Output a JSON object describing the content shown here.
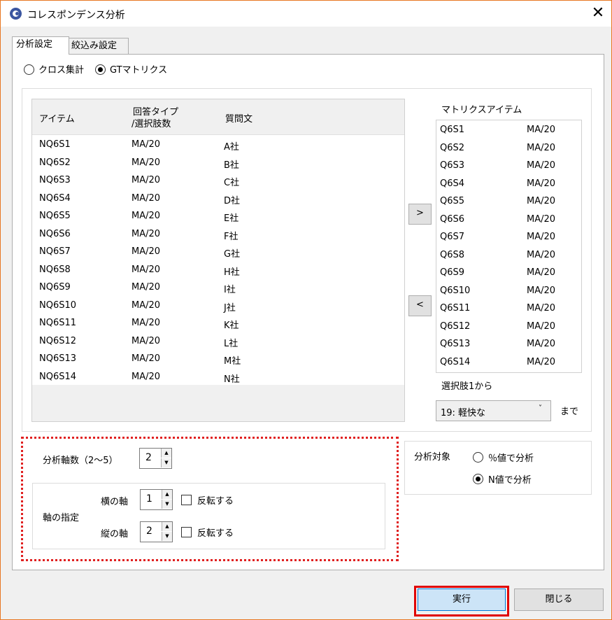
{
  "window": {
    "title": "コレスポンデンス分析"
  },
  "tabs": [
    "分析設定",
    "絞込み設定"
  ],
  "mode": {
    "options": [
      "クロス集計",
      "GTマトリクス"
    ],
    "selected": 1
  },
  "left_list": {
    "headers": {
      "item": "アイテム",
      "type_line1": "回答タイプ",
      "type_line2": "/選択肢数",
      "question": "質問文"
    },
    "rows": [
      [
        "NQ6S1",
        "MA/20",
        "A社"
      ],
      [
        "NQ6S2",
        "MA/20",
        "B社"
      ],
      [
        "NQ6S3",
        "MA/20",
        "C社"
      ],
      [
        "NQ6S4",
        "MA/20",
        "D社"
      ],
      [
        "NQ6S5",
        "MA/20",
        "E社"
      ],
      [
        "NQ6S6",
        "MA/20",
        "F社"
      ],
      [
        "NQ6S7",
        "MA/20",
        "G社"
      ],
      [
        "NQ6S8",
        "MA/20",
        "H社"
      ],
      [
        "NQ6S9",
        "MA/20",
        "I社"
      ],
      [
        "NQ6S10",
        "MA/20",
        "J社"
      ],
      [
        "NQ6S11",
        "MA/20",
        "K社"
      ],
      [
        "NQ6S12",
        "MA/20",
        "L社"
      ],
      [
        "NQ6S13",
        "MA/20",
        "M社"
      ],
      [
        "NQ6S14",
        "MA/20",
        "N社"
      ]
    ]
  },
  "move_buttons": {
    "add": ">",
    "remove": "<"
  },
  "matrix": {
    "label": "マトリクスアイテム",
    "rows": [
      [
        "Q6S1",
        "MA/20"
      ],
      [
        "Q6S2",
        "MA/20"
      ],
      [
        "Q6S3",
        "MA/20"
      ],
      [
        "Q6S4",
        "MA/20"
      ],
      [
        "Q6S5",
        "MA/20"
      ],
      [
        "Q6S6",
        "MA/20"
      ],
      [
        "Q6S7",
        "MA/20"
      ],
      [
        "Q6S8",
        "MA/20"
      ],
      [
        "Q6S9",
        "MA/20"
      ],
      [
        "Q6S10",
        "MA/20"
      ],
      [
        "Q6S11",
        "MA/20"
      ],
      [
        "Q6S12",
        "MA/20"
      ],
      [
        "Q6S13",
        "MA/20"
      ],
      [
        "Q6S14",
        "MA/20"
      ]
    ],
    "range_from_label": "選択肢1から",
    "range_to_value": "19: 軽快な",
    "range_to_suffix": "まで"
  },
  "axes": {
    "count_label": "分析軸数（2～5）",
    "count_value": "2",
    "spec_label": "軸の指定",
    "horizontal_label": "横の軸",
    "horizontal_value": "1",
    "vertical_label": "縦の軸",
    "vertical_value": "2",
    "invert_label": "反転する"
  },
  "target": {
    "label": "分析対象",
    "options": [
      "％値で分析",
      "N値で分析"
    ],
    "selected": 1
  },
  "footer": {
    "run": "実行",
    "close": "閉じる"
  },
  "colors": {
    "highlight_red": "#e00000",
    "run_button_bg": "#cce4f7",
    "window_border": "#e87722"
  }
}
